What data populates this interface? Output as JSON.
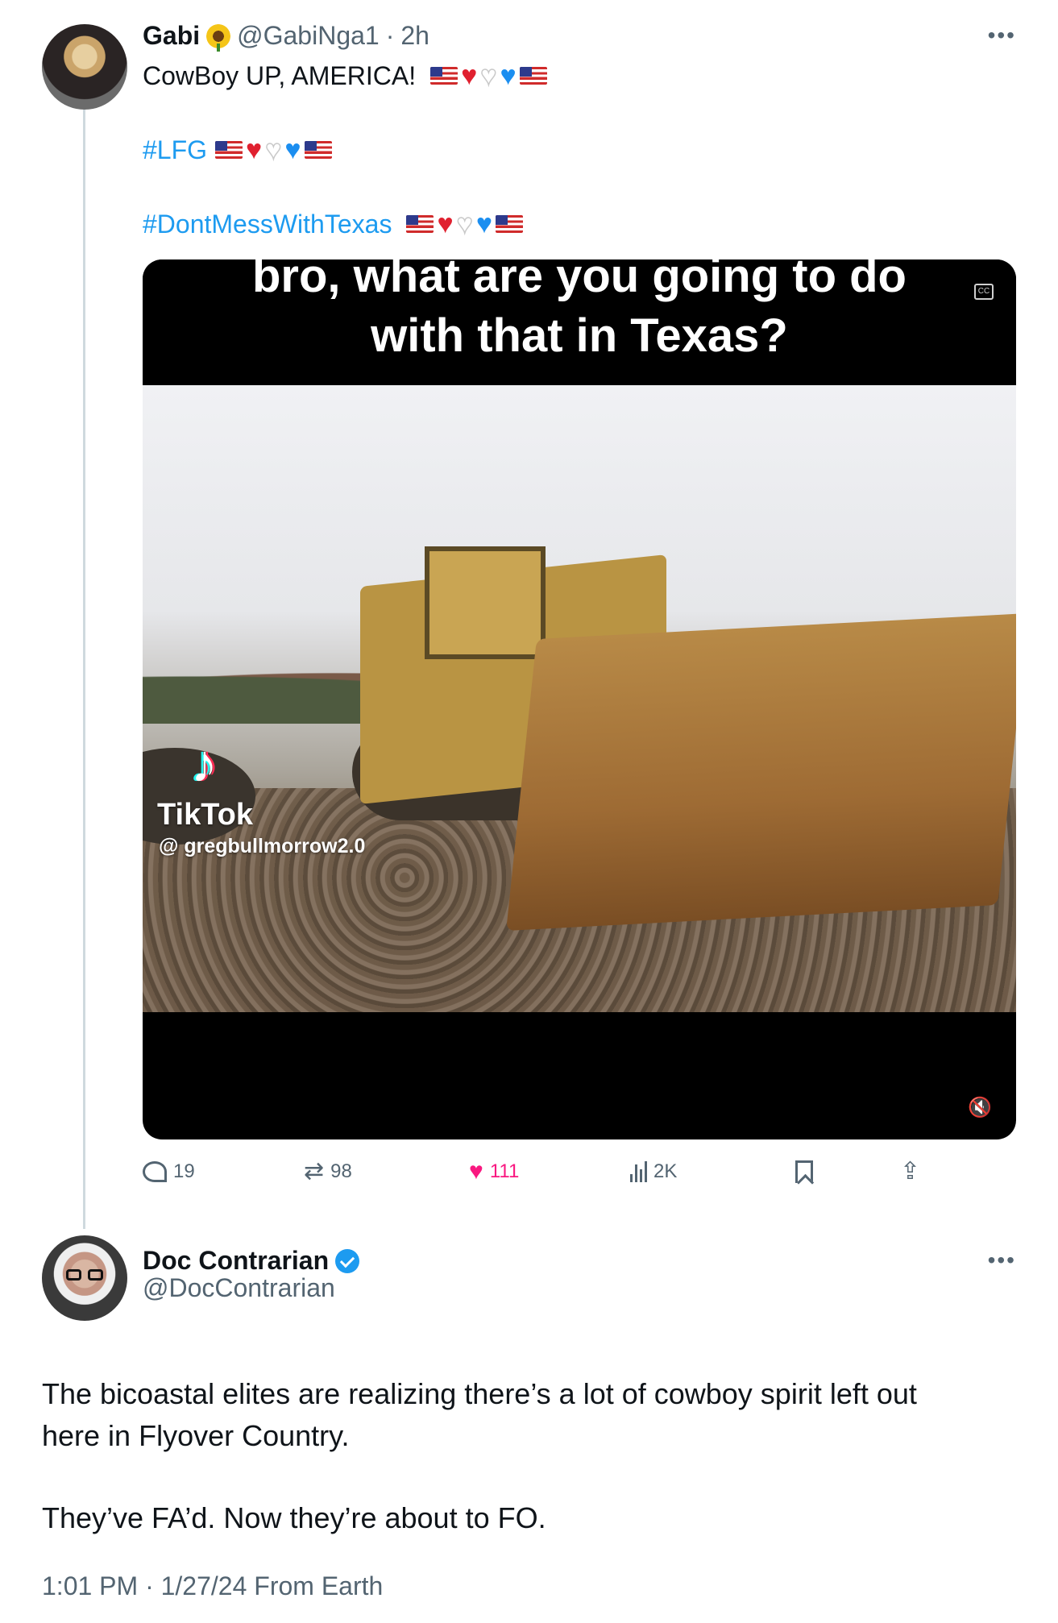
{
  "tweet": {
    "author_name": "Gabi",
    "author_handle": "@GabiNga1",
    "separator": "·",
    "time_ago": "2h",
    "more_label": "•••",
    "line1": "CowBoy UP, AMERICA!",
    "hashtag1": "#LFG",
    "hashtag2": "#DontMessWithTexas",
    "media": {
      "caption_line1": "bro, what are you going to do",
      "caption_line2": "with that in Texas?",
      "watermark_brand": "TikTok",
      "watermark_user": "@ gregbullmorrow2.0",
      "cc_label": "CC"
    },
    "actions": {
      "replies": "19",
      "retweets": "98",
      "likes": "111",
      "views": "2K"
    }
  },
  "reply": {
    "author_name": "Doc Contrarian",
    "author_handle": "@DocContrarian",
    "more_label": "•••",
    "paragraph1_line1": "The bicoastal elites are realizing there’s a lot of cowboy spirit left out",
    "paragraph1_line2": "here in Flyover Country.",
    "paragraph2": "They’ve FA’d. Now they’re about to FO.",
    "meta": "1:01 PM · 1/27/24 From Earth"
  },
  "colors": {
    "link": "#1d9bf0",
    "secondary_text": "#536471",
    "like_active": "#f91880",
    "verified": "#1d9bf0"
  },
  "icons": [
    "sunflower-icon",
    "us-flag-icon",
    "red-heart-icon",
    "white-heart-icon",
    "blue-heart-icon",
    "reply-icon",
    "retweet-icon",
    "like-icon",
    "views-icon",
    "bookmark-icon",
    "share-icon",
    "verified-icon",
    "mute-icon",
    "captions-icon",
    "tiktok-icon"
  ]
}
